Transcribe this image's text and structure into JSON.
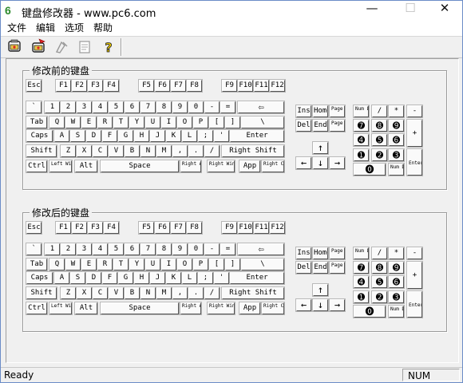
{
  "window": {
    "icon": "6",
    "title": "键盘修改器 - www.pc6.com",
    "minimize": "—",
    "maximize": "☐",
    "close": "✕"
  },
  "menu": [
    "文件",
    "编辑",
    "选项",
    "帮助"
  ],
  "toolbar": {
    "icons": [
      "open-icon",
      "reset-icon",
      "edit-icon",
      "preview-icon",
      "help-icon"
    ],
    "help_glyph": "?"
  },
  "groups": {
    "before_title": "修改前的键盘",
    "after_title": "修改后的键盘"
  },
  "keys": {
    "esc": "Esc",
    "f1": "F1",
    "f2": "F2",
    "f3": "F3",
    "f4": "F4",
    "f5": "F5",
    "f6": "F6",
    "f7": "F7",
    "f8": "F8",
    "f9": "F9",
    "f10": "F10",
    "f11": "F11",
    "f12": "F12",
    "backtick": "`",
    "n1": "1",
    "n2": "2",
    "n3": "3",
    "n4": "4",
    "n5": "5",
    "n6": "6",
    "n7": "7",
    "n8": "8",
    "n9": "9",
    "n0": "0",
    "minus": "-",
    "equals": "=",
    "backspace": "⇦",
    "tab": "Tab",
    "q": "Q",
    "w": "W",
    "e": "E",
    "r": "R",
    "t": "T",
    "y": "Y",
    "u": "U",
    "i": "I",
    "o": "O",
    "p": "P",
    "lbracket": "[",
    "rbracket": "]",
    "backslash": "\\",
    "caps": "Caps",
    "a": "A",
    "s": "S",
    "d": "D",
    "f": "F",
    "g": "G",
    "h": "H",
    "j": "J",
    "k": "K",
    "l": "L",
    "semicolon": ";",
    "quote": "'",
    "enter": "Enter",
    "lshift": "Shift",
    "z": "Z",
    "x": "X",
    "c": "C",
    "v": "V",
    "b": "B",
    "n": "N",
    "m": "M",
    "comma": ",",
    "period": ".",
    "slash": "/",
    "rshift": "Right Shift",
    "ctrl": "Ctrl",
    "lwin": "Left Windows",
    "alt": "Alt",
    "space": "Space",
    "ralt": "Right Alt",
    "rwin": "Right Windows",
    "app": "App",
    "rctrl": "Right Ctrl",
    "ins": "Ins",
    "home": "Home",
    "pgup": "Page Up",
    "del": "Del",
    "end": "End",
    "pgdn": "Page Down",
    "up": "↑",
    "left": "←",
    "down": "↓",
    "right": "→",
    "numlock": "Num Lock",
    "ndiv": "/",
    "nmul": "*",
    "nsub": "-",
    "n7k": "➐",
    "n8k": "➑",
    "n9k": "➒",
    "nadd": "+",
    "n4k": "➍",
    "n5k": "➎",
    "n6k": "➏",
    "n1k": "➊",
    "n2k": "➋",
    "n3k": "➌",
    "nenter": "Enter",
    "n0k": "⓿",
    "ndel": "Num Del"
  },
  "status": {
    "left": "Ready",
    "right": "NUM"
  }
}
